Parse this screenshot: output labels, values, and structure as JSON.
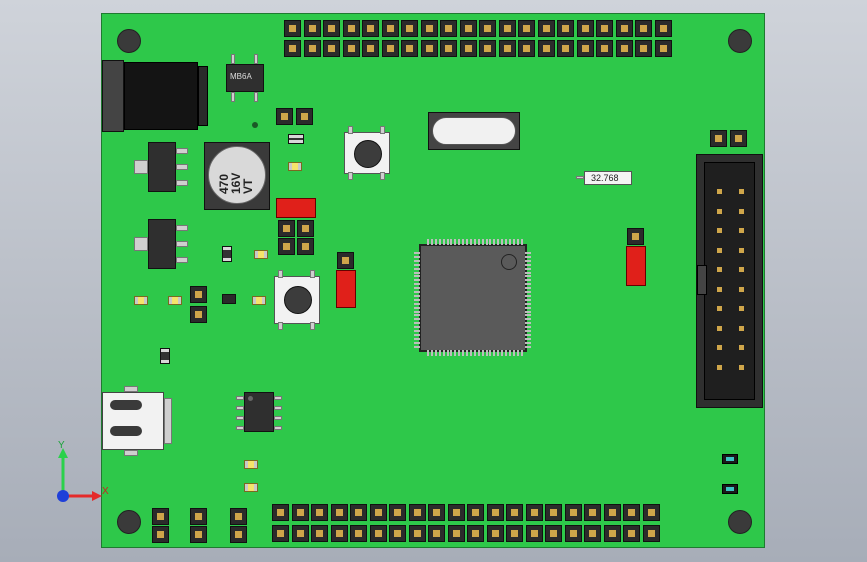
{
  "components": {
    "bridge_label": "MB6A",
    "capacitor_label": "470\n16V\nVT",
    "crystal_small_label": "32.768"
  },
  "triad": {
    "y_label": "Y",
    "x_label": "X"
  },
  "colors": {
    "board": "#2ec84a",
    "viewport": "#c0c5ce",
    "jumper": "#e0201a",
    "pin_gold": "#cfa64a"
  }
}
